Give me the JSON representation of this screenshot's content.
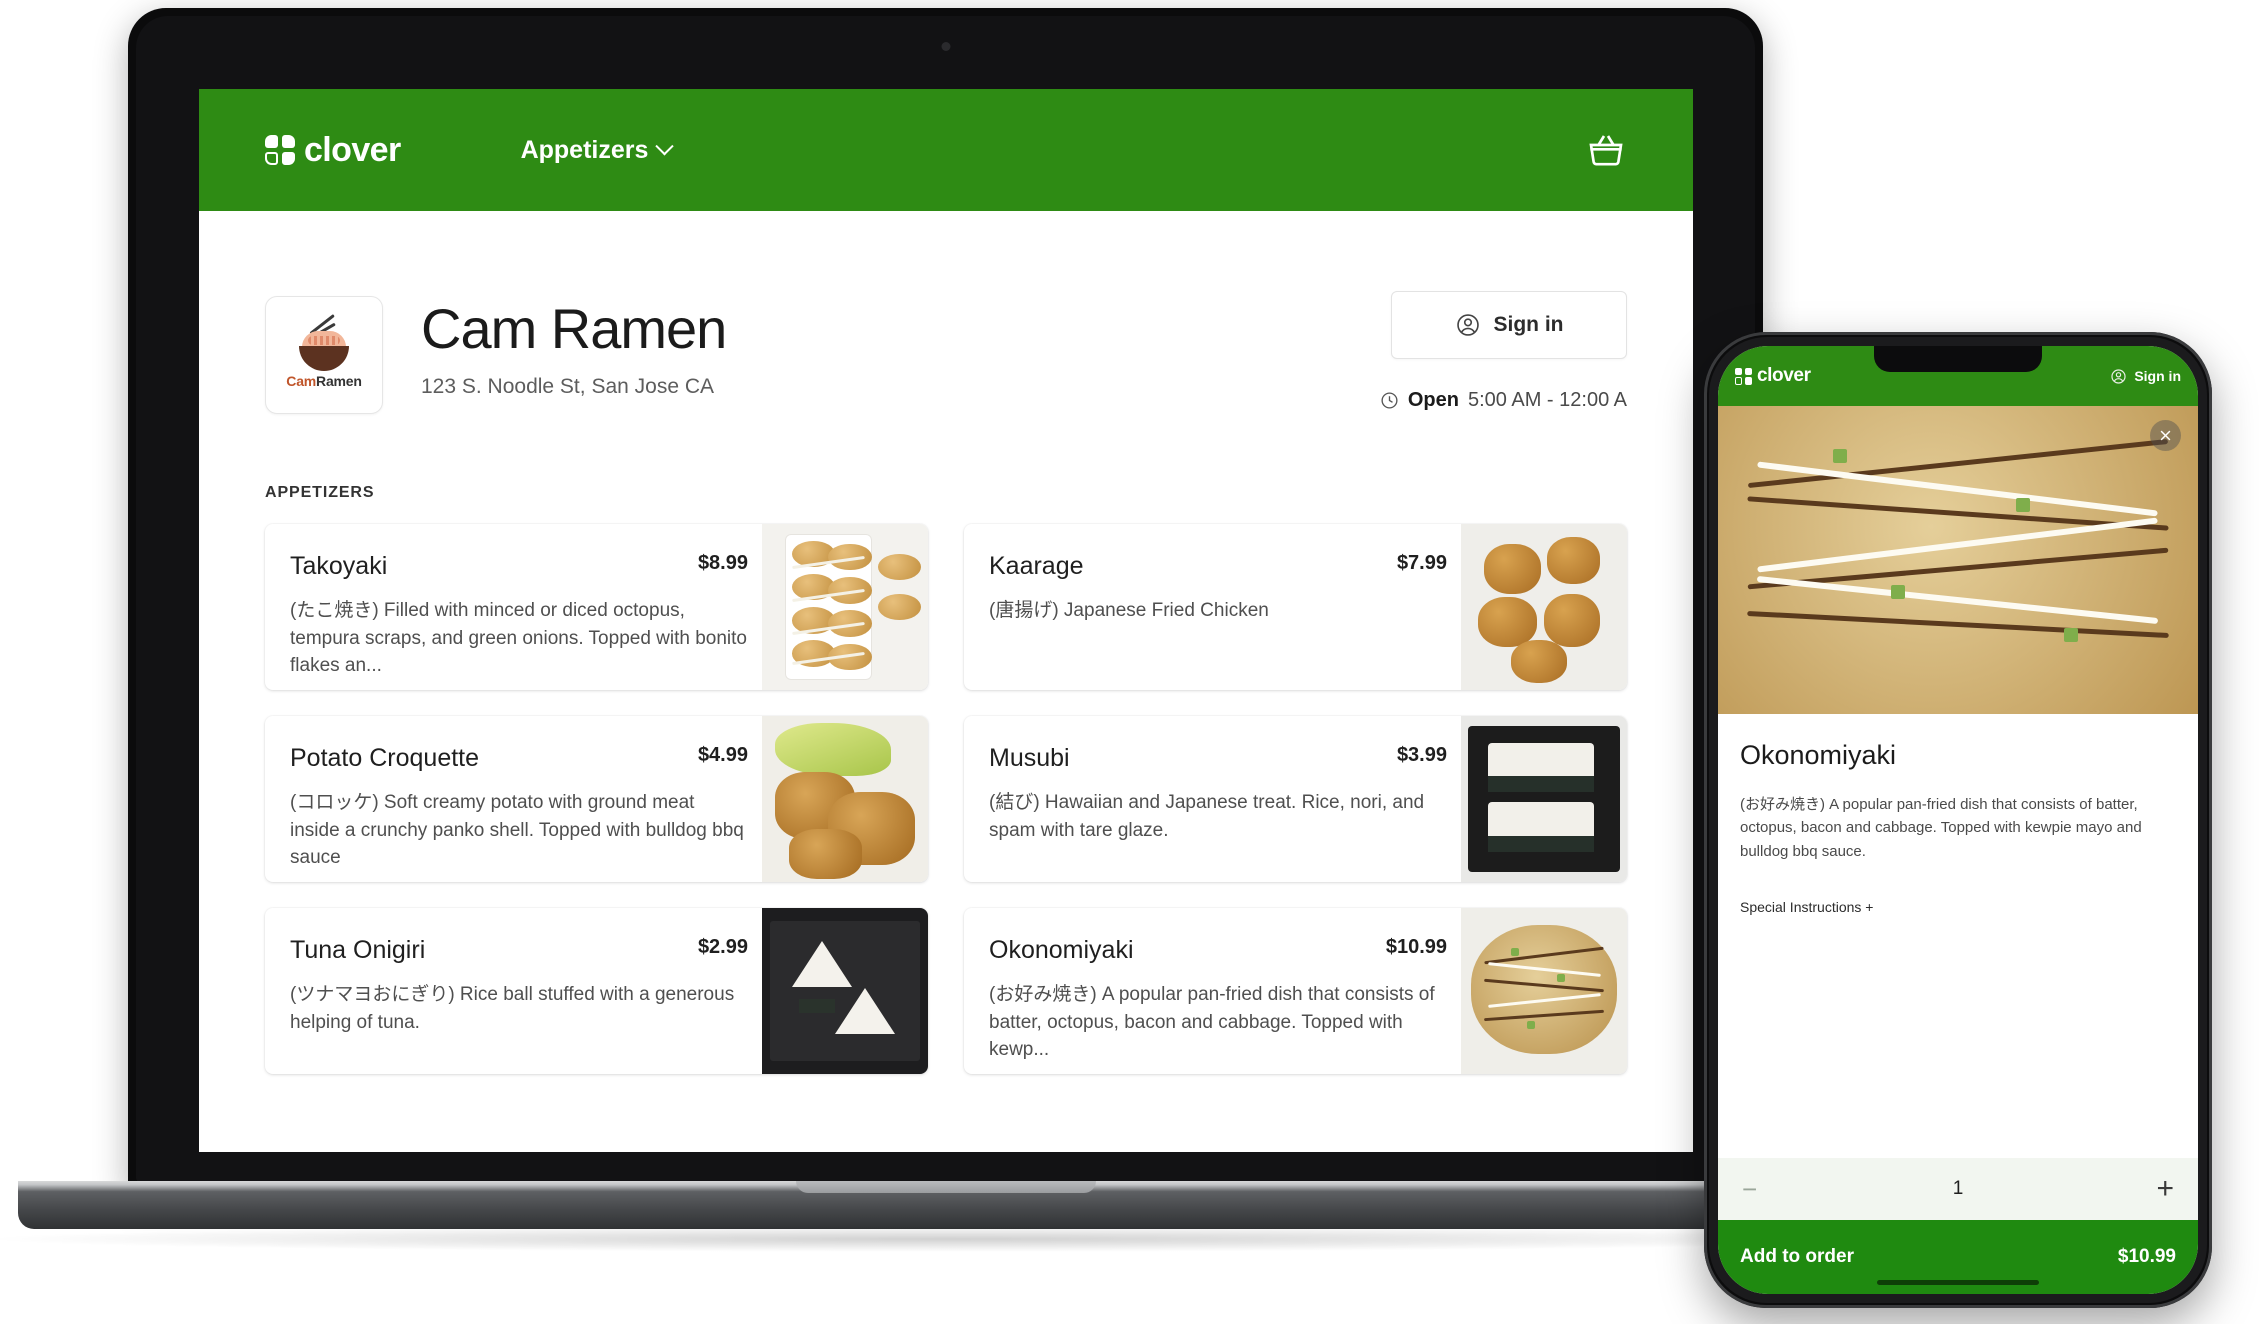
{
  "web": {
    "brand": "clover",
    "brand_icon": "clover-logo-icon",
    "nav_category": "Appetizers",
    "nav_chevron_icon": "chevron-down-icon",
    "cart_icon": "shopping-basket-icon",
    "signin_label": "Sign in",
    "signin_icon": "user-circle-icon",
    "clock_icon": "clock-icon",
    "hours_status": "Open",
    "hours_range": "5:00 AM - 12:00 A",
    "restaurant": {
      "name": "Cam Ramen",
      "address": "123 S. Noodle St, San Jose CA",
      "logo_icon": "ramen-bowl-icon",
      "logo_word_1": "Cam",
      "logo_word_2": "Ramen"
    },
    "section_label": "APPETIZERS",
    "items": [
      {
        "name": "Takoyaki",
        "price": "$8.99",
        "desc": "(たこ焼き) Filled with minced or diced octopus, tempura scraps, and green onions. Topped with bonito flakes an...",
        "image": "takoyaki-photo"
      },
      {
        "name": "Kaarage",
        "price": "$7.99",
        "desc": "(唐揚げ) Japanese Fried Chicken",
        "image": "kaarage-photo"
      },
      {
        "name": "Potato Croquette",
        "price": "$4.99",
        "desc": "(コロッケ) Soft creamy potato with ground meat inside a crunchy panko shell. Topped with bulldog bbq sauce",
        "image": "croquette-photo"
      },
      {
        "name": "Musubi",
        "price": "$3.99",
        "desc": "(結び) Hawaiian and Japanese treat. Rice, nori, and spam with tare glaze.",
        "image": "musubi-photo"
      },
      {
        "name": "Tuna Onigiri",
        "price": "$2.99",
        "desc": "(ツナマヨおにぎり) Rice ball stuffed with a generous helping of tuna.",
        "image": "onigiri-photo"
      },
      {
        "name": "Okonomiyaki",
        "price": "$10.99",
        "desc": "(お好み焼き) A popular pan-fried dish that consists of batter, octopus, bacon and cabbage. Topped with kewp...",
        "image": "okonomiyaki-photo"
      }
    ]
  },
  "phone": {
    "brand": "clover",
    "brand_icon": "clover-logo-icon",
    "signin_label": "Sign in",
    "signin_icon": "user-circle-icon",
    "close_icon": "close-x-icon",
    "hero_image": "okonomiyaki-photo",
    "item_title": "Okonomiyaki",
    "item_desc": "(お好み焼き) A popular pan-fried dish that consists of batter, octopus, bacon and cabbage. Topped with kewpie mayo and bulldog bbq sauce.",
    "special_instructions": "Special Instructions +",
    "qty_minus_icon": "minus-icon",
    "qty_value": "1",
    "qty_plus_icon": "plus-icon",
    "cta_label": "Add to order",
    "cta_price": "$10.99"
  },
  "colors": {
    "brand_green": "#2E8B14",
    "cta_green": "#1F8A10",
    "qty_bg": "#F2F6F0"
  }
}
